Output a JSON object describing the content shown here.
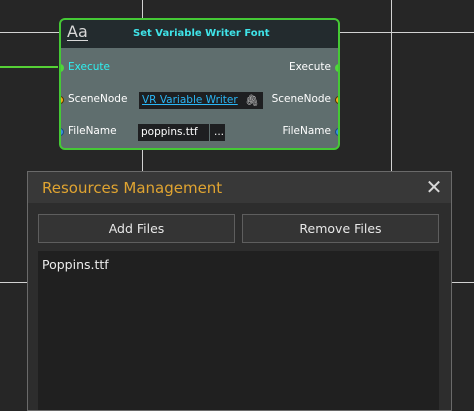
{
  "node": {
    "icon": "font-icon",
    "icon_glyph": "Aa",
    "title": "Set Variable Writer Font",
    "inputs": {
      "execute": "Execute",
      "scene_node": "SceneNode",
      "file_name": "FileName"
    },
    "outputs": {
      "execute": "Execute",
      "scene_node": "SceneNode",
      "file_name": "FileName"
    },
    "scene_node_value": "VR Variable Writer",
    "file_name_value": "poppins.ttf",
    "browse_label": "...",
    "colors": {
      "border": "#45c935",
      "title": "#3fe3e8",
      "exec_pin": "#4fd63b",
      "scene_pin": "#f2aa19",
      "file_pin": "#3a8fdc"
    }
  },
  "dialog": {
    "title": "Resources Management",
    "close_glyph": "✕",
    "add_files_label": "Add Files",
    "remove_files_label": "Remove Files",
    "files": [
      "Poppins.ttf"
    ],
    "title_color": "#e0a431"
  }
}
